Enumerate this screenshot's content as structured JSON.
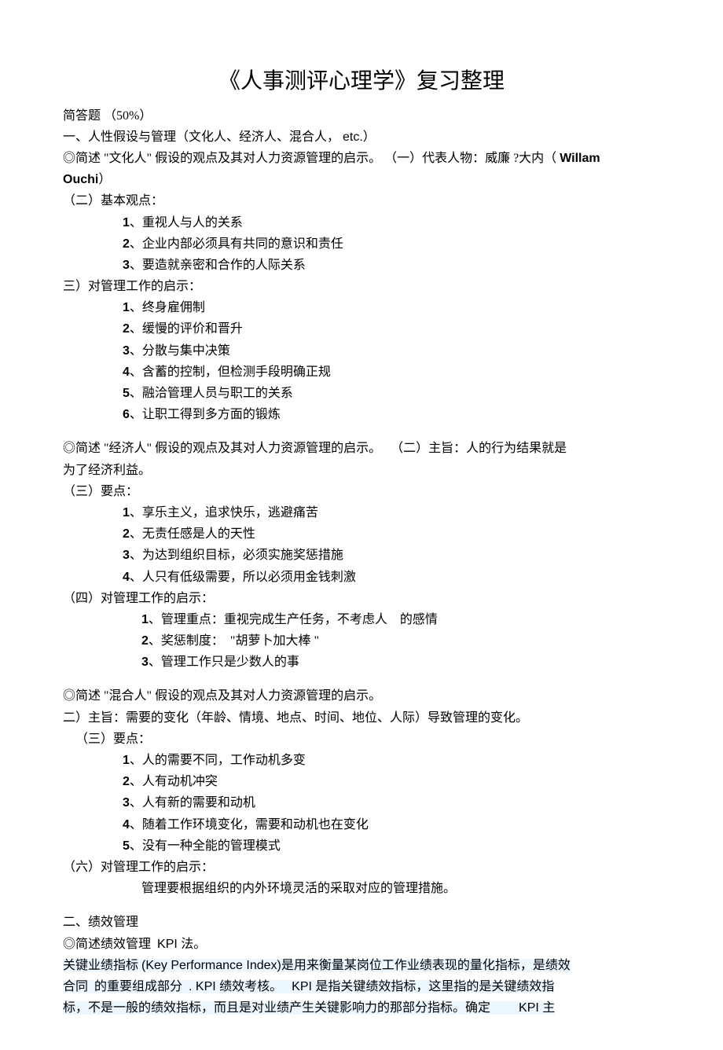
{
  "title": "《人事测评心理学》复习整理",
  "intro": {
    "l1": "简答题 （50%）",
    "l2_a": "一、人性假设与管理（文化人、经济人、混合人，",
    "l2_b": "etc.）",
    "l3_a": "◎简述 \"文化人\" 假设的观点及其对人力资源管理的启示。",
    "l3_b": "（一）代表人物：威廉 ?大内（",
    "l3_c": "Willam",
    "l4_a": "Ouchi",
    "l4_b": "）"
  },
  "s1": {
    "h2": "（二）基本观点：",
    "i1_a": "1",
    "i1_b": "、重视人与人的关系",
    "i2_a": "2",
    "i2_b": "、企业内部必须具有共同的意识和责任",
    "i3_a": "3",
    "i3_b": "、要造就亲密和合作的人际关系",
    "h3": "三）对管理工作的启示：",
    "j1_a": "1",
    "j1_b": "、终身雇佣制",
    "j2_a": "2",
    "j2_b": "、缓慢的评价和晋升",
    "j3_a": "3",
    "j3_b": "、分散与集中决策",
    "j4_a": "4",
    "j4_b": "、含蓄的控制，但检测手段明确正规",
    "j5_a": "5",
    "j5_b": "、融洽管理人员与职工的关系",
    "j6_a": "6",
    "j6_b": "、让职工得到多方面的锻炼"
  },
  "s2": {
    "l1_a": "◎简述 \"经济人\" 假设的观点及其对人力资源管理的启示。",
    "l1_b": "（二）主旨：人的行为结果就是",
    "l2": "为了经济利益。",
    "h3": "（三）要点：",
    "i1_a": "1",
    "i1_b": "、享乐主义，追求快乐，逃避痛苦",
    "i2_a": "2",
    "i2_b": "、无责任感是人的天性",
    "i3_a": "3",
    "i3_b": "、为达到组织目标，必须实施奖惩措施",
    "i4_a": "4",
    "i4_b": "、人只有低级需要，所以必须用金钱刺激",
    "h4": "（四）对管理工作的启示：",
    "j1_a": "1",
    "j1_b": "、管理重点：重视完成生产任务，不考虑人",
    "j1_c": "的感情",
    "j2_a": "2",
    "j2_b": "、奖惩制度：",
    "j2_c": "\"胡萝卜加大棒",
    "j2_d": "\"",
    "j3_a": "3",
    "j3_b": "、管理工作只是少数人的事"
  },
  "s3": {
    "l1": "◎简述 \"混合人\" 假设的观点及其对人力资源管理的启示。",
    "l2": "二）主旨：需要的变化（年龄、情境、地点、时间、地位、人际）导致管理的变化。",
    "h3": "（三）要点：",
    "i1_a": "1",
    "i1_b": "、人的需要不同，工作动机多变",
    "i2_a": "2",
    "i2_b": "、人有动机冲突",
    "i3_a": "3",
    "i3_b": "、人有新的需要和动机",
    "i4_a": "4",
    "i4_b": "、随着工作环境变化，需要和动机也在变化",
    "i5_a": "5",
    "i5_b": "、没有一种全能的管理模式",
    "h6": "（六）对管理工作的启示：",
    "j1": "管理要根据组织的内外环境灵活的采取对应的管理措施。"
  },
  "s4": {
    "l1": "二、绩效管理",
    "l2_a": "◎简述绩效管理",
    "l2_b": "KPI 法。",
    "p_a": "关键业绩指标",
    "p_b": "(Key Performance Index)是用来衡量某岗位工作业绩表现的量化指标，是绩效",
    "p_c": "合同",
    "p_d": "的重要组成部分",
    "p_e": ". KPI 绩效考核。",
    "p_f": "KPI 是指关键绩效指标，这里指的是关键绩效指",
    "p_g": "标，不是一般的绩效指标，而且是对业绩产生关键影响力的那部分指标。确定",
    "p_h": "KPI 主"
  }
}
